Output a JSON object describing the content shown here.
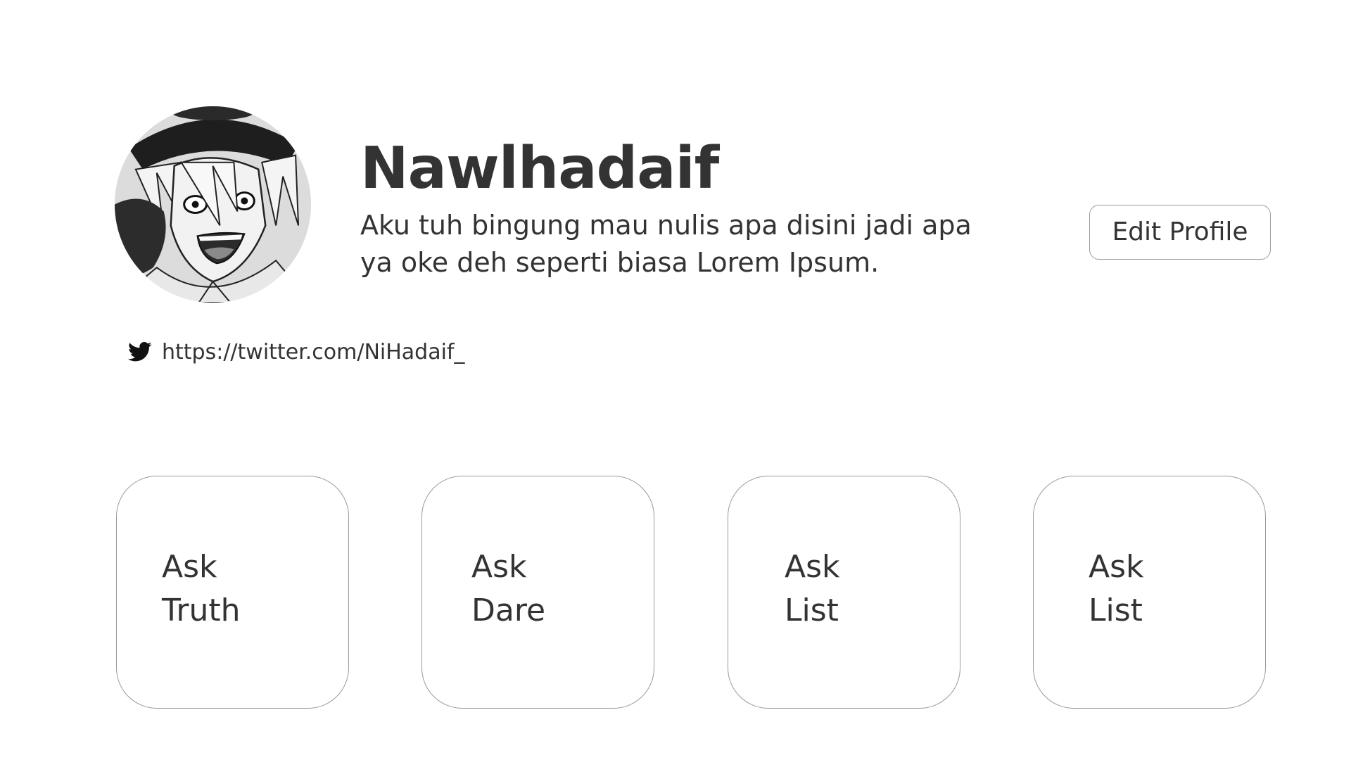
{
  "profile": {
    "name": "Nawlhadaif",
    "bio": "Aku tuh bingung mau nulis apa disini jadi apa ya oke deh seperti biasa Lorem Ipsum.",
    "edit_button_label": "Edit Profile",
    "avatar_icon": "anime-character-avatar"
  },
  "social": {
    "icon": "twitter-icon",
    "twitter_url": "https://twitter.com/NiHadaif_"
  },
  "cards": [
    {
      "line1": "Ask",
      "line2": "Truth"
    },
    {
      "line1": "Ask",
      "line2": "Dare"
    },
    {
      "line1": "Ask",
      "line2": "List"
    },
    {
      "line1": "Ask",
      "line2": "List"
    }
  ],
  "colors": {
    "text": "#333333",
    "border": "#9a9a9a",
    "background": "#ffffff"
  }
}
